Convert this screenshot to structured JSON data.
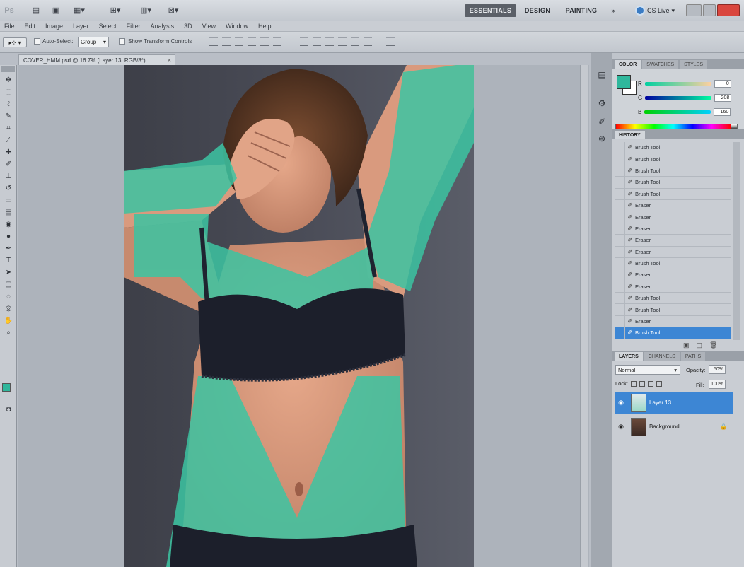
{
  "menu": [
    "File",
    "Edit",
    "Image",
    "Layer",
    "Select",
    "Filter",
    "Analysis",
    "3D",
    "View",
    "Window",
    "Help"
  ],
  "workspace": {
    "essentials": "ESSENTIALS",
    "design": "DESIGN",
    "painting": "PAINTING",
    "more": "»",
    "cslive": "CS Live"
  },
  "options": {
    "auto_select_label": "Auto-Select:",
    "auto_select_value": "Group",
    "transform_label": "Show Transform Controls"
  },
  "document": {
    "tab_title": "COVER_HMM.psd @ 16.7% (Layer 13, RGB/8*)",
    "close": "×"
  },
  "color_panel": {
    "tabs": [
      "Color",
      "Swatches",
      "Styles"
    ],
    "fg_color": "#2fb79c",
    "sliders": [
      {
        "label": "R",
        "value": "0"
      },
      {
        "label": "G",
        "value": "208"
      },
      {
        "label": "B",
        "value": "160"
      }
    ]
  },
  "history_panel": {
    "tabs": [
      "History"
    ],
    "items": [
      "Brush Tool",
      "Brush Tool",
      "Brush Tool",
      "Brush Tool",
      "Brush Tool",
      "Eraser",
      "Eraser",
      "Eraser",
      "Eraser",
      "Eraser",
      "Brush Tool",
      "Eraser",
      "Eraser",
      "Brush Tool",
      "Brush Tool",
      "Eraser",
      "Brush Tool"
    ],
    "selected_index": 16
  },
  "layers_panel": {
    "tabs": [
      "Layers",
      "Channels",
      "Paths"
    ],
    "blend_mode": "Normal",
    "opacity_label": "Opacity:",
    "opacity": "50%",
    "lock_label": "Lock:",
    "fill_label": "Fill:",
    "fill": "100%",
    "layers": [
      {
        "name": "Layer 13",
        "selected": true
      },
      {
        "name": "Background",
        "selected": false
      }
    ]
  },
  "colors": {
    "accent": "#2fb79c",
    "selection": "#3d86d4"
  }
}
